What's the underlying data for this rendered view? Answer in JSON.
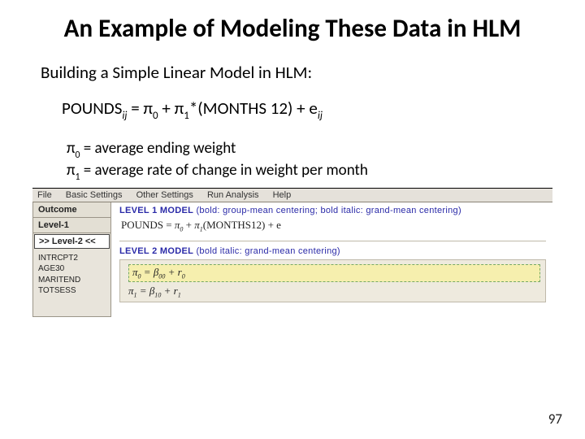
{
  "title": "An Example of Modeling These Data in HLM",
  "subtitle": "Building a Simple Linear Model in HLM:",
  "equation": {
    "lhs": "POUNDS",
    "lhs_sub": "ij",
    "eq1": " = π",
    "s0": "0",
    "plus": " + π",
    "s1": "1",
    "rhs": "*(MONTHS 12) + e",
    "rhs_sub": "ij"
  },
  "defs": {
    "line1_a": "π",
    "line1_s": "0",
    "line1_b": " = average ending weight",
    "line2_a": "π",
    "line2_s": "1",
    "line2_b": " = average rate of change in weight per month"
  },
  "app": {
    "menu": {
      "file": "File",
      "basic": "Basic Settings",
      "other": "Other Settings",
      "run": "Run Analysis",
      "help": "Help"
    },
    "side": {
      "outcome": "Outcome",
      "level1": "Level-1",
      "level2": ">> Level-2 <<"
    },
    "vars": {
      "v1": "INTRCPT2",
      "v2": "AGE30",
      "v3": "MARITEND",
      "v4": "TOTSESS"
    },
    "lvl1": {
      "head_b": "LEVEL 1 MODEL",
      "head_r": " (bold: group-mean centering; bold italic: grand-mean centering)",
      "eq_a": "POUNDS  =  ",
      "eq_p0": "π",
      "eq_s0": "0",
      "eq_mid": " + ",
      "eq_p1": "π",
      "eq_s1": "1",
      "eq_b": "(MONTHS12) + e"
    },
    "lvl2": {
      "head_b": "LEVEL 2 MODEL",
      "head_r": " (bold italic: grand-mean centering)",
      "r1_a": "π",
      "r1_s": "0",
      "r1_mid": "  =  β",
      "r1_bs": "00",
      "r1_end": " + r",
      "r1_rs": "0",
      "r2_a": "π",
      "r2_s": "1",
      "r2_mid": "  =  β",
      "r2_bs": "10",
      "r2_end": " + r",
      "r2_rs": "1"
    }
  },
  "pagenum": "97"
}
